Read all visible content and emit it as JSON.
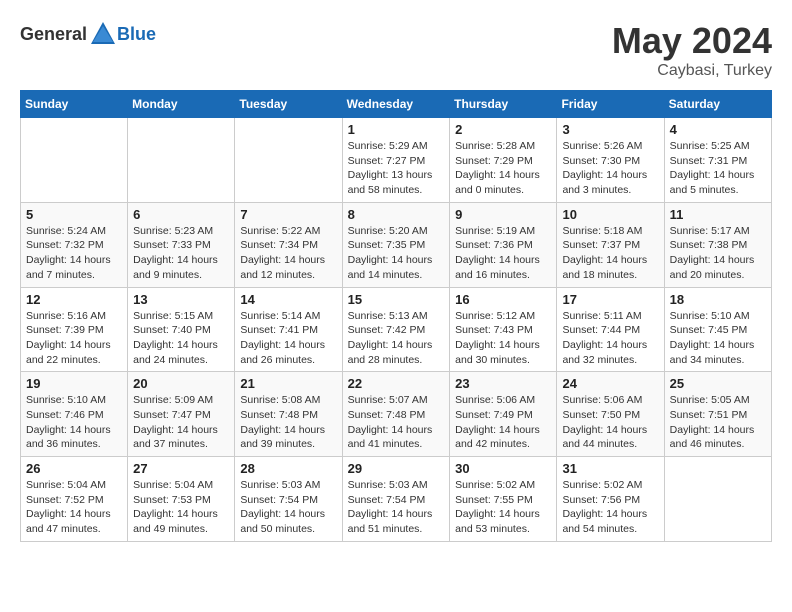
{
  "header": {
    "logo_general": "General",
    "logo_blue": "Blue",
    "month": "May 2024",
    "location": "Caybasi, Turkey"
  },
  "weekdays": [
    "Sunday",
    "Monday",
    "Tuesday",
    "Wednesday",
    "Thursday",
    "Friday",
    "Saturday"
  ],
  "weeks": [
    [
      {
        "day": "",
        "info": ""
      },
      {
        "day": "",
        "info": ""
      },
      {
        "day": "",
        "info": ""
      },
      {
        "day": "1",
        "info": "Sunrise: 5:29 AM\nSunset: 7:27 PM\nDaylight: 13 hours\nand 58 minutes."
      },
      {
        "day": "2",
        "info": "Sunrise: 5:28 AM\nSunset: 7:29 PM\nDaylight: 14 hours\nand 0 minutes."
      },
      {
        "day": "3",
        "info": "Sunrise: 5:26 AM\nSunset: 7:30 PM\nDaylight: 14 hours\nand 3 minutes."
      },
      {
        "day": "4",
        "info": "Sunrise: 5:25 AM\nSunset: 7:31 PM\nDaylight: 14 hours\nand 5 minutes."
      }
    ],
    [
      {
        "day": "5",
        "info": "Sunrise: 5:24 AM\nSunset: 7:32 PM\nDaylight: 14 hours\nand 7 minutes."
      },
      {
        "day": "6",
        "info": "Sunrise: 5:23 AM\nSunset: 7:33 PM\nDaylight: 14 hours\nand 9 minutes."
      },
      {
        "day": "7",
        "info": "Sunrise: 5:22 AM\nSunset: 7:34 PM\nDaylight: 14 hours\nand 12 minutes."
      },
      {
        "day": "8",
        "info": "Sunrise: 5:20 AM\nSunset: 7:35 PM\nDaylight: 14 hours\nand 14 minutes."
      },
      {
        "day": "9",
        "info": "Sunrise: 5:19 AM\nSunset: 7:36 PM\nDaylight: 14 hours\nand 16 minutes."
      },
      {
        "day": "10",
        "info": "Sunrise: 5:18 AM\nSunset: 7:37 PM\nDaylight: 14 hours\nand 18 minutes."
      },
      {
        "day": "11",
        "info": "Sunrise: 5:17 AM\nSunset: 7:38 PM\nDaylight: 14 hours\nand 20 minutes."
      }
    ],
    [
      {
        "day": "12",
        "info": "Sunrise: 5:16 AM\nSunset: 7:39 PM\nDaylight: 14 hours\nand 22 minutes."
      },
      {
        "day": "13",
        "info": "Sunrise: 5:15 AM\nSunset: 7:40 PM\nDaylight: 14 hours\nand 24 minutes."
      },
      {
        "day": "14",
        "info": "Sunrise: 5:14 AM\nSunset: 7:41 PM\nDaylight: 14 hours\nand 26 minutes."
      },
      {
        "day": "15",
        "info": "Sunrise: 5:13 AM\nSunset: 7:42 PM\nDaylight: 14 hours\nand 28 minutes."
      },
      {
        "day": "16",
        "info": "Sunrise: 5:12 AM\nSunset: 7:43 PM\nDaylight: 14 hours\nand 30 minutes."
      },
      {
        "day": "17",
        "info": "Sunrise: 5:11 AM\nSunset: 7:44 PM\nDaylight: 14 hours\nand 32 minutes."
      },
      {
        "day": "18",
        "info": "Sunrise: 5:10 AM\nSunset: 7:45 PM\nDaylight: 14 hours\nand 34 minutes."
      }
    ],
    [
      {
        "day": "19",
        "info": "Sunrise: 5:10 AM\nSunset: 7:46 PM\nDaylight: 14 hours\nand 36 minutes."
      },
      {
        "day": "20",
        "info": "Sunrise: 5:09 AM\nSunset: 7:47 PM\nDaylight: 14 hours\nand 37 minutes."
      },
      {
        "day": "21",
        "info": "Sunrise: 5:08 AM\nSunset: 7:48 PM\nDaylight: 14 hours\nand 39 minutes."
      },
      {
        "day": "22",
        "info": "Sunrise: 5:07 AM\nSunset: 7:48 PM\nDaylight: 14 hours\nand 41 minutes."
      },
      {
        "day": "23",
        "info": "Sunrise: 5:06 AM\nSunset: 7:49 PM\nDaylight: 14 hours\nand 42 minutes."
      },
      {
        "day": "24",
        "info": "Sunrise: 5:06 AM\nSunset: 7:50 PM\nDaylight: 14 hours\nand 44 minutes."
      },
      {
        "day": "25",
        "info": "Sunrise: 5:05 AM\nSunset: 7:51 PM\nDaylight: 14 hours\nand 46 minutes."
      }
    ],
    [
      {
        "day": "26",
        "info": "Sunrise: 5:04 AM\nSunset: 7:52 PM\nDaylight: 14 hours\nand 47 minutes."
      },
      {
        "day": "27",
        "info": "Sunrise: 5:04 AM\nSunset: 7:53 PM\nDaylight: 14 hours\nand 49 minutes."
      },
      {
        "day": "28",
        "info": "Sunrise: 5:03 AM\nSunset: 7:54 PM\nDaylight: 14 hours\nand 50 minutes."
      },
      {
        "day": "29",
        "info": "Sunrise: 5:03 AM\nSunset: 7:54 PM\nDaylight: 14 hours\nand 51 minutes."
      },
      {
        "day": "30",
        "info": "Sunrise: 5:02 AM\nSunset: 7:55 PM\nDaylight: 14 hours\nand 53 minutes."
      },
      {
        "day": "31",
        "info": "Sunrise: 5:02 AM\nSunset: 7:56 PM\nDaylight: 14 hours\nand 54 minutes."
      },
      {
        "day": "",
        "info": ""
      }
    ]
  ]
}
